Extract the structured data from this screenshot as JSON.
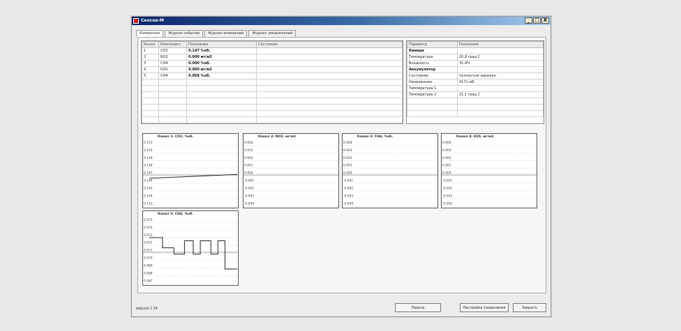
{
  "window": {
    "title": "Сенсон-М",
    "controls": {
      "minimize": "_",
      "maximize": "□",
      "close": "X"
    }
  },
  "tabs": [
    "Измерения",
    "Журнал событий",
    "Журнал измерений",
    "Журнал уведомлений"
  ],
  "measure_table": {
    "headers": [
      "Канал",
      "Компонент",
      "Показания",
      "Состояние"
    ],
    "rows": [
      [
        "1",
        "CO2",
        "0.147 %об.",
        ""
      ],
      [
        "2",
        "NO2",
        "0.000 мг/м3",
        ""
      ],
      [
        "3",
        "CH4",
        "0.000 %об.",
        ""
      ],
      [
        "4",
        "H2S",
        "0.000 мг/м3",
        ""
      ],
      [
        "5",
        "CH4",
        "0.068 %об.",
        ""
      ]
    ]
  },
  "param_table": {
    "headers": [
      "Параметр",
      "Показания"
    ],
    "rows": [
      [
        "Камера",
        ""
      ],
      [
        "Температура",
        "20.8 град С"
      ],
      [
        "Влажность",
        "31.4%"
      ],
      [
        "Аккумулятор",
        ""
      ],
      [
        "Состояние",
        "полностью заряжен"
      ],
      [
        "Напряжение",
        "4171 мВ"
      ],
      [
        "Температура 1",
        ""
      ],
      [
        "Температура 2",
        "21.1 град С"
      ]
    ]
  },
  "chart_data": [
    {
      "type": "line",
      "title": "Канал 1: CO2, %об.",
      "yticks": [
        "0.151",
        "0.150",
        "0.149",
        "0.148",
        "0.147",
        "0.146",
        "0.145",
        "0.144",
        "0.143"
      ],
      "ylim": [
        0.143,
        0.151
      ],
      "x": [
        0,
        1
      ],
      "values": [
        0.1463,
        0.1468
      ]
    },
    {
      "type": "line",
      "title": "Канал 2: NO2, мг/м3",
      "yticks": [
        "0.004",
        "0.003",
        "0.002",
        "0.001",
        "0.000",
        "-0.001",
        "-0.002",
        "-0.003",
        "-0.004"
      ],
      "ylim": [
        -0.004,
        0.004
      ]
    },
    {
      "type": "line",
      "title": "Канал 3: CH4, %об.",
      "yticks": [
        "0.004",
        "0.003",
        "0.002",
        "0.001",
        "0.000",
        "-0.001",
        "-0.002",
        "-0.003",
        "-0.004"
      ],
      "ylim": [
        -0.004,
        0.004
      ]
    },
    {
      "type": "line",
      "title": "Канал 4: H2S, мг/м3",
      "yticks": [
        "0.004",
        "0.003",
        "0.002",
        "0.001",
        "0.000",
        "-0.001",
        "-0.002",
        "-0.003",
        "-0.004"
      ],
      "ylim": [
        -0.004,
        0.004
      ]
    },
    {
      "type": "line",
      "title": "Канал 5: CH4, %об.",
      "yticks": [
        "0.075",
        "0.074",
        "0.073",
        "0.072",
        "0.071",
        "0.070",
        "0.069",
        "0.068",
        "0.067"
      ],
      "ylim": [
        0.067,
        0.075
      ],
      "x": [
        0,
        0.04,
        0.15,
        0.15,
        0.28,
        0.28,
        0.4,
        0.4,
        0.5,
        0.5,
        0.58,
        0.58,
        0.7,
        0.7,
        0.78,
        0.78,
        0.86,
        0.86,
        1.0
      ],
      "values": [
        0.0726,
        0.0726,
        0.0726,
        0.0713,
        0.0713,
        0.0705,
        0.0705,
        0.0722,
        0.0722,
        0.0705,
        0.0705,
        0.0722,
        0.0722,
        0.0705,
        0.0705,
        0.0722,
        0.0722,
        0.0686,
        0.0686
      ]
    }
  ],
  "status": {
    "version": "версия 1.34",
    "buttons": [
      "Пароль",
      "Настройка соединения",
      "Закрыть"
    ]
  }
}
